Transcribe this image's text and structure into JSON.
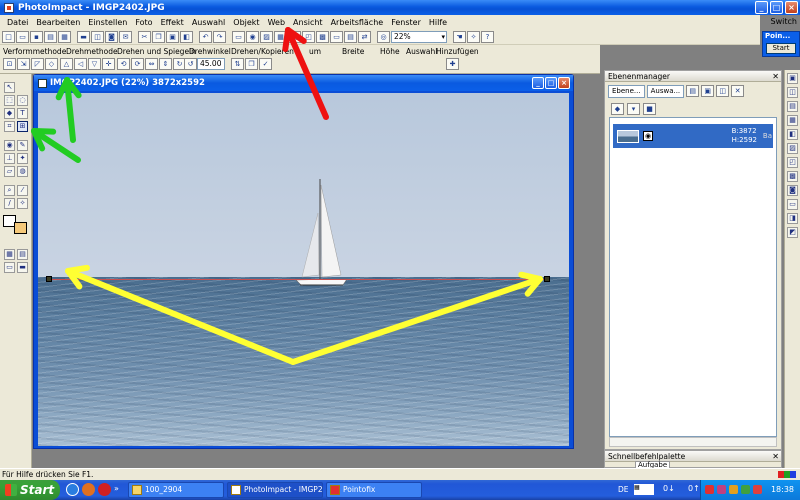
{
  "app": {
    "title": "PhotoImpact - IMGP2402.JPG",
    "window_buttons": [
      "_",
      "□",
      "×"
    ]
  },
  "menu": {
    "items": [
      "Datei",
      "Bearbeiten",
      "Einstellen",
      "Foto",
      "Effekt",
      "Auswahl",
      "Objekt",
      "Web",
      "Ansicht",
      "Arbeitsfläche",
      "Fenster",
      "Hilfe"
    ],
    "switch_label": "Switch"
  },
  "toolbar": {
    "zoom_value": "22%"
  },
  "options_bar": {
    "verformmethode": "Verformmethode",
    "drehmethode": "Drehmethode",
    "drehen_spiegeln": "Drehen und Spiegeln",
    "drehwinkel": "Drehwinkel",
    "drehwinkel_value": "45.00",
    "drehen_kopieren": "Drehen/Kopieren",
    "zentrum": "um",
    "breite": "Breite",
    "hoehe": "Höhe",
    "auswahl": "Auswahl",
    "hinzufuegen": "Hinzufügen"
  },
  "document": {
    "title": "IMGP2402.JPG (22%) 3872x2592"
  },
  "layer_panel": {
    "title": "Ebenenmanager",
    "tab_layers": "Ebene...",
    "tab_selection": "Auswa...",
    "layer_width": "B:3872",
    "layer_height": "H:2592",
    "layer_name": "Ba"
  },
  "quick_panel": {
    "title": "Schnellbefehlpalette",
    "tab": "Aufgabe"
  },
  "pointofix": {
    "title": "Poin...",
    "start": "Start"
  },
  "status": {
    "text": "Für Hilfe drücken Sie F1."
  },
  "taskbar": {
    "start": "Start",
    "tasks": [
      "100_2904",
      "PhotoImpact - IMGP2...",
      "Pointofix"
    ],
    "lang": "DE",
    "clock": "18:38"
  },
  "colors": {
    "arrow_yellow": "#ffff33",
    "arrow_green": "#22cc22",
    "arrow_red": "#ee1111",
    "selection": "#316ac5"
  }
}
